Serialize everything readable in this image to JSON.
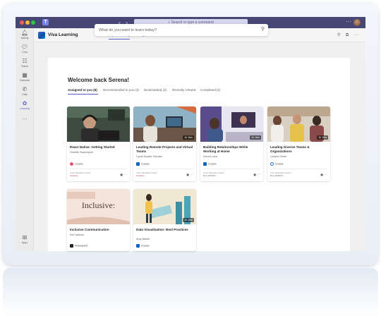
{
  "titlebar": {
    "search_placeholder": "Search or type a command",
    "back_arrow": "‹",
    "forward_arrow": "›",
    "more": "···"
  },
  "rail": [
    {
      "label": "Activity",
      "icon": "bell-icon",
      "glyph": "🔔︎"
    },
    {
      "label": "Chat",
      "icon": "chat-icon",
      "glyph": "💬︎"
    },
    {
      "label": "Teams",
      "icon": "teams-icon",
      "glyph": "☷"
    },
    {
      "label": "Calendar",
      "icon": "calendar-icon",
      "glyph": "▦"
    },
    {
      "label": "Calls",
      "icon": "phone-icon",
      "glyph": "✆"
    },
    {
      "label": "Learning",
      "icon": "learning-icon",
      "glyph": "✿"
    },
    {
      "label": "...",
      "icon": "more-icon",
      "glyph": "···"
    },
    {
      "label": "Apps",
      "icon": "apps-icon",
      "glyph": "⊞"
    }
  ],
  "app": {
    "name": "Viva Learning",
    "tabs": [
      "Home",
      "My Learning",
      "Manage"
    ],
    "active_tab": "My Learning"
  },
  "search": {
    "placeholder": "What do you want to learn today?"
  },
  "welcome": "Welcome back Serena!",
  "filter_tabs": [
    "Assigned to you (6)",
    "Recommended to you (3)",
    "Bookmarked (3)",
    "Recently Viewed",
    "Completed (2)"
  ],
  "cards": [
    {
      "title": "React Native: Getting Started",
      "author": "Hendrik Swanepoel",
      "type": "Course",
      "type_color": "#e8557a",
      "duration": "",
      "source": "From Discipline Genie",
      "status": "Overdue"
    },
    {
      "title": "Leading Remote Projects and Virtual Teams",
      "author": "Cyndi Snyder Dionisio",
      "type": "Course",
      "type_color": "#0a66c2",
      "duration": "1h 15m",
      "source": "From Discipline Genie",
      "status": "Overdue"
    },
    {
      "title": "Building Relationships While Working at Home",
      "author": "Devon Lane",
      "type": "Course",
      "type_color": "#0a66c2",
      "duration": "1h 15m",
      "source": "From Discipline Genie",
      "status": "Due 10/15/21"
    },
    {
      "title": "Leading Diverse Teams & Organizations",
      "author": "Lindred Greer",
      "type": "Course",
      "type_color": "#1f6ecf",
      "duration": "1h 15m",
      "source": "From Discipline Genie",
      "status": "Due 10/15/21"
    },
    {
      "title": "Inclusive Communication",
      "author": "Kat Larsson",
      "type": "Powerpoint",
      "type_color": "#242424",
      "duration": "",
      "thumb_text": "Inclusive:",
      "source": "",
      "status": ""
    },
    {
      "title": "Data Visualization: Best Practices",
      "author": "Amy Balliet",
      "type": "Course",
      "type_color": "#0a66c2",
      "duration": "1h 15m",
      "source": "",
      "status": ""
    }
  ],
  "colors": {
    "titlebar": "#464775",
    "accent": "#5b5fc7",
    "overdue": "#c4314b"
  }
}
